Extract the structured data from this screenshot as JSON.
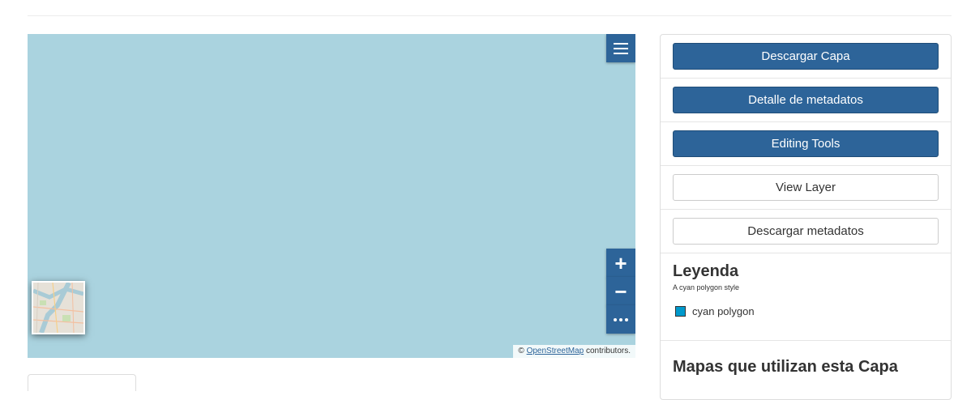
{
  "map": {
    "menu_icon": "hamburger-menu-icon",
    "zoom_in_label": "+",
    "zoom_out_label": "−",
    "more_icon": "ellipsis-icon",
    "attribution": {
      "prefix": "©",
      "link_text": "OpenStreetMap",
      "suffix": "contributors."
    },
    "colors": {
      "water": "#aad3df",
      "control": "#2d6499"
    }
  },
  "panel": {
    "buttons": [
      {
        "label": "Descargar Capa",
        "style": "primary"
      },
      {
        "label": "Detalle de metadatos",
        "style": "primary"
      },
      {
        "label": "Editing Tools",
        "style": "primary"
      },
      {
        "label": "View Layer",
        "style": "default"
      },
      {
        "label": "Descargar metadatos",
        "style": "default"
      }
    ],
    "legend": {
      "title": "Leyenda",
      "style_title": "A cyan polygon style",
      "items": [
        {
          "label": "cyan polygon",
          "color": "#0099cc"
        }
      ]
    },
    "maps_title": "Mapas que utilizan esta Capa"
  }
}
